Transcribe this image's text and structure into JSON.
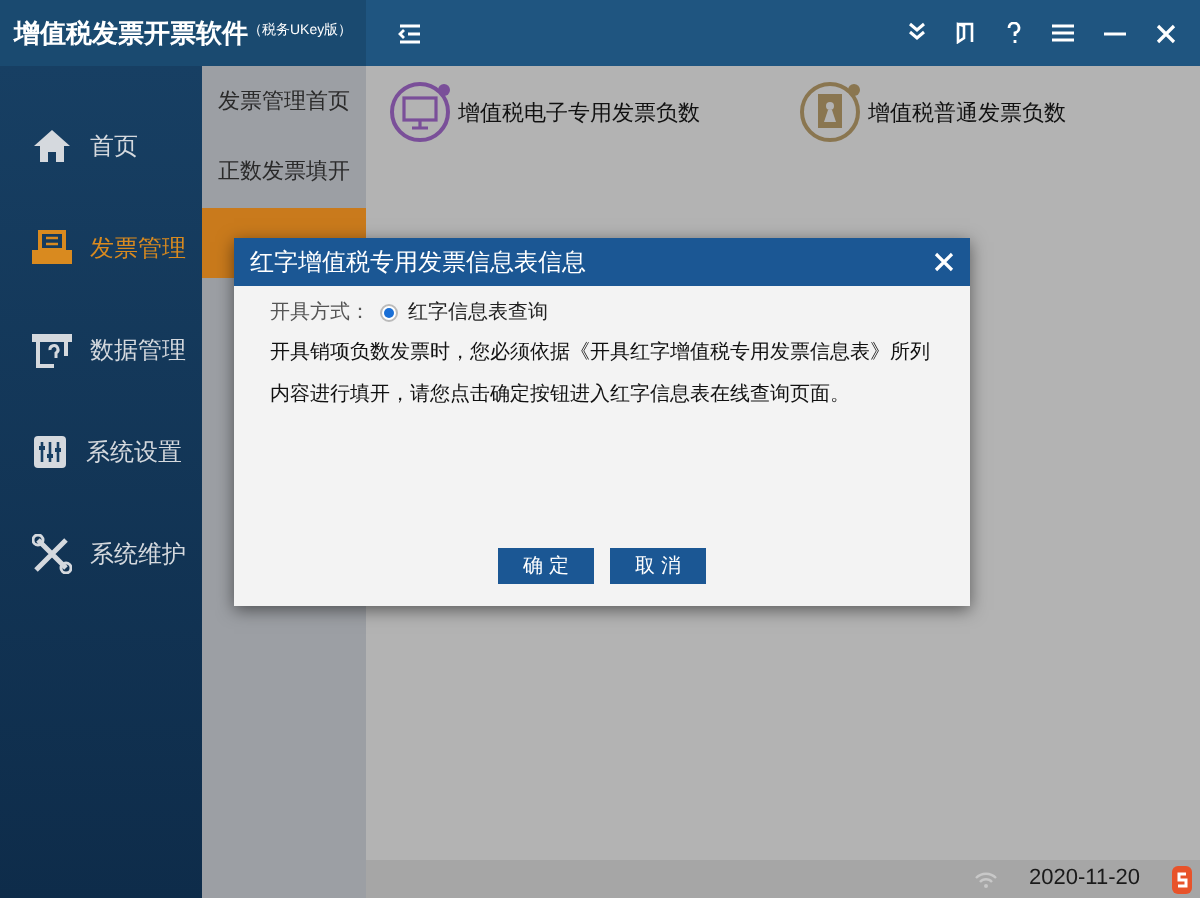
{
  "window": {
    "title": "增值税发票开票软件",
    "subtitle": "（税务UKey版）"
  },
  "sidebar": {
    "items": [
      {
        "label": "首页",
        "selected": false
      },
      {
        "label": "发票管理",
        "selected": true
      },
      {
        "label": "数据管理",
        "selected": false
      },
      {
        "label": "系统设置",
        "selected": false
      },
      {
        "label": "系统维护",
        "selected": false
      }
    ]
  },
  "submenu": {
    "items": [
      {
        "label": "发票管理首页",
        "selected": false
      },
      {
        "label": "正数发票填开",
        "selected": false
      },
      {
        "selected": true
      }
    ]
  },
  "content": {
    "cards": [
      {
        "label": "增值税电子专用发票负数",
        "color": "#7a4f99"
      },
      {
        "label": "增值税普通发票负数",
        "color": "#8a7650"
      }
    ]
  },
  "dialog": {
    "title": "红字增值税专用发票信息表信息",
    "field_label": "开具方式：",
    "option": {
      "label": "红字信息表查询",
      "selected": true
    },
    "message": "开具销项负数发票时，您必须依据《开具红字增值税专用发票信息表》所列内容进行填开，请您点击确定按钮进入红字信息表在线查询页面。",
    "buttons": [
      "确 定",
      "取 消"
    ]
  },
  "status_bar": {
    "date": "2020-11-20"
  }
}
